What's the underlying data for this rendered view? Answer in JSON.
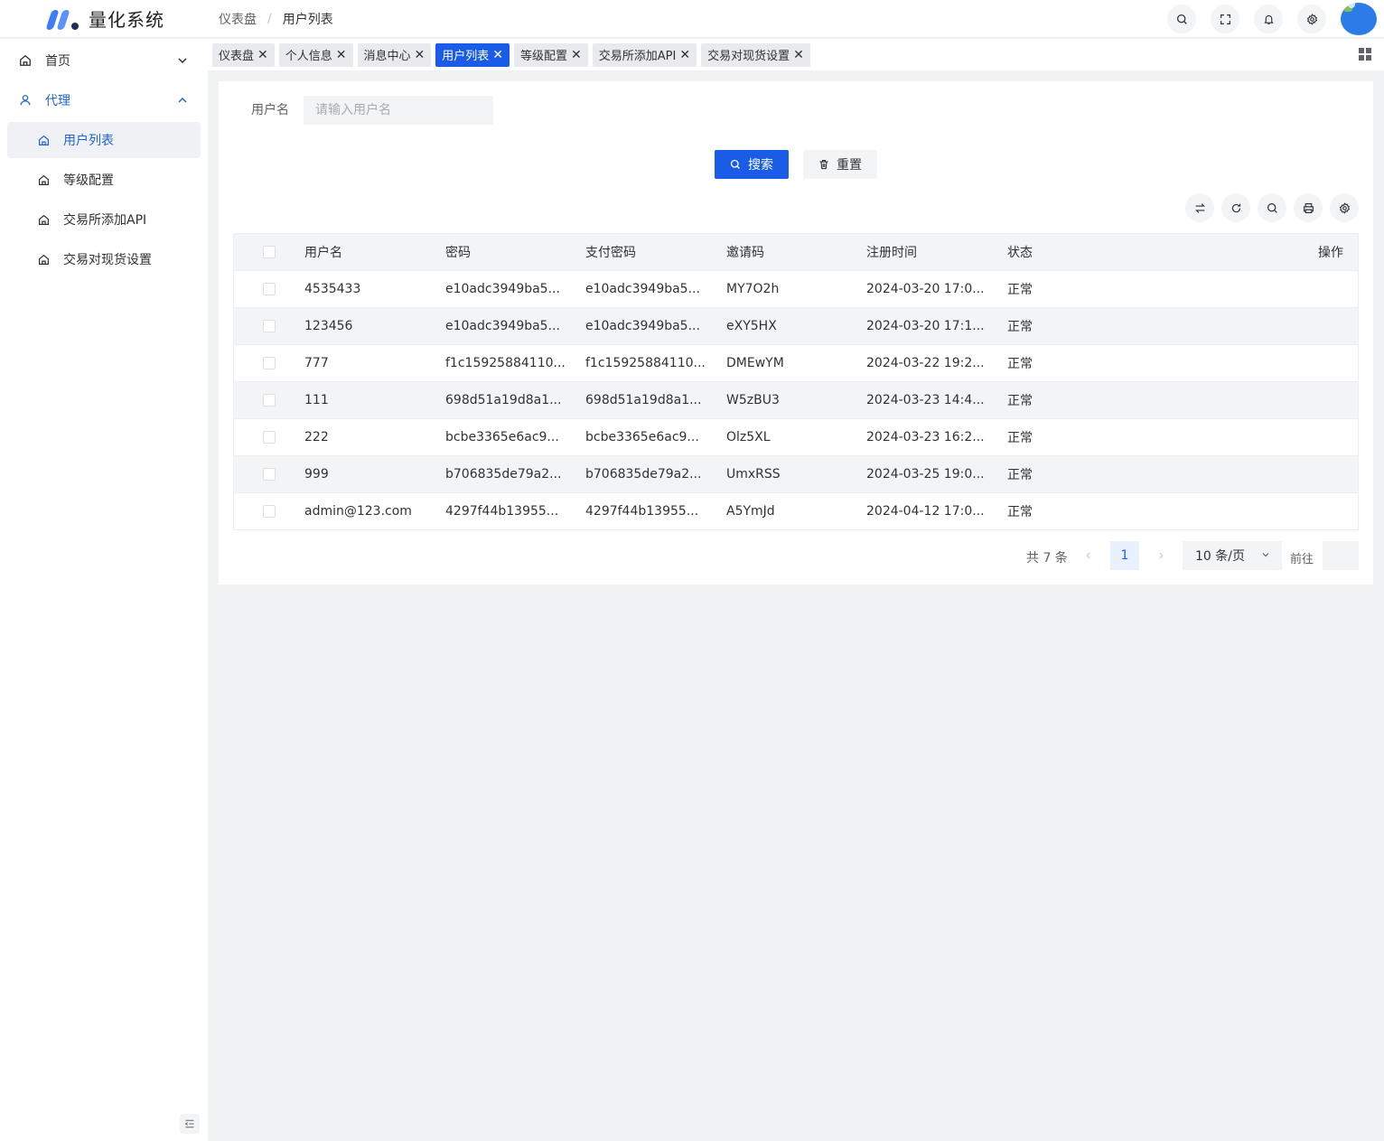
{
  "app": {
    "title": "量化系统"
  },
  "breadcrumb": [
    "仪表盘",
    "用户列表"
  ],
  "sidebar": {
    "items": [
      {
        "label": "首页"
      },
      {
        "label": "代理"
      },
      {
        "label": "用户列表"
      },
      {
        "label": "等级配置"
      },
      {
        "label": "交易所添加API"
      },
      {
        "label": "交易对现货设置"
      }
    ]
  },
  "tabs": [
    {
      "label": "仪表盘"
    },
    {
      "label": "个人信息"
    },
    {
      "label": "消息中心"
    },
    {
      "label": "用户列表"
    },
    {
      "label": "等级配置"
    },
    {
      "label": "交易所添加API"
    },
    {
      "label": "交易对现货设置"
    }
  ],
  "search": {
    "label": "用户名",
    "placeholder": "请输入用户名",
    "search_btn": "搜索",
    "reset_btn": "重置"
  },
  "table": {
    "headers": [
      "用户名",
      "密码",
      "支付密码",
      "邀请码",
      "注册时间",
      "状态",
      "操作"
    ],
    "rows": [
      [
        "4535433",
        "e10adc3949ba5...",
        "e10adc3949ba5...",
        "MY7O2h",
        "2024-03-20 17:0...",
        "正常"
      ],
      [
        "123456",
        "e10adc3949ba5...",
        "e10adc3949ba5...",
        "eXY5HX",
        "2024-03-20 17:1...",
        "正常"
      ],
      [
        "777",
        "f1c15925884110...",
        "f1c15925884110...",
        "DMEwYM",
        "2024-03-22 19:2...",
        "正常"
      ],
      [
        "111",
        "698d51a19d8a1...",
        "698d51a19d8a1...",
        "W5zBU3",
        "2024-03-23 14:4...",
        "正常"
      ],
      [
        "222",
        "bcbe3365e6ac9...",
        "bcbe3365e6ac9...",
        "Olz5XL",
        "2024-03-23 16:2...",
        "正常"
      ],
      [
        "999",
        "b706835de79a2...",
        "b706835de79a2...",
        "UmxRSS",
        "2024-03-25 19:0...",
        "正常"
      ],
      [
        "admin@123.com",
        "4297f44b13955...",
        "4297f44b13955...",
        "A5YmJd",
        "2024-04-12 17:0...",
        "正常"
      ]
    ]
  },
  "pagination": {
    "total": "共 7 条",
    "current_page": "1",
    "page_size": "10 条/页",
    "goto_label": "前往"
  },
  "colors": {
    "primary": "#1a5ce8",
    "text": "#303133",
    "bg": "#f1f2f4"
  }
}
